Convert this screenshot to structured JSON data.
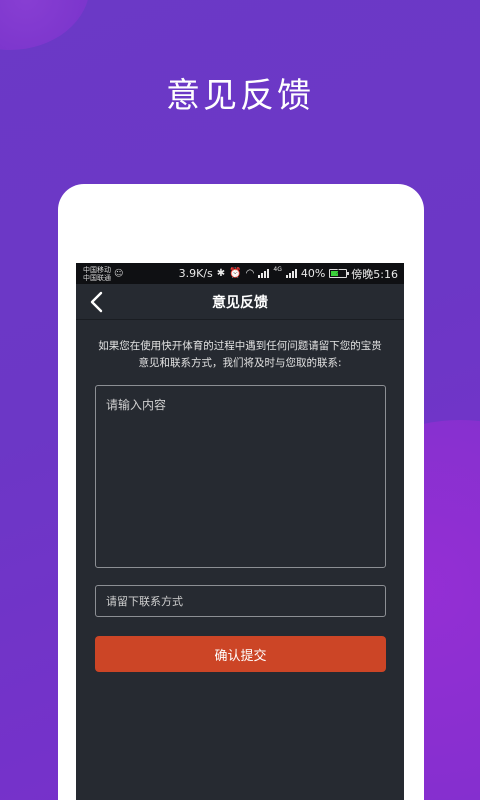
{
  "promo": {
    "headline": "意见反馈"
  },
  "status_bar": {
    "carrier_1": "中国移动",
    "carrier_2": "中国联通",
    "net_speed": "3.9K/s",
    "network_type": "4G",
    "battery_percent": "40%",
    "time": "傍晚5:16",
    "battery_level": 0.4
  },
  "app_bar": {
    "title": "意见反馈",
    "back_icon": "chevron-left-icon"
  },
  "form": {
    "description": "如果您在使用快开体育的过程中遇到任何问题请留下您的宝贵意见和联系方式，我们将及时与您取的联系:",
    "content_placeholder": "请输入内容",
    "contact_placeholder": "请留下联系方式",
    "submit_label": "确认提交"
  },
  "colors": {
    "background_purple": "#6a37c4",
    "screen_dark": "#262a31",
    "submit_button": "#cc4526",
    "battery_green": "#3bd13b"
  }
}
